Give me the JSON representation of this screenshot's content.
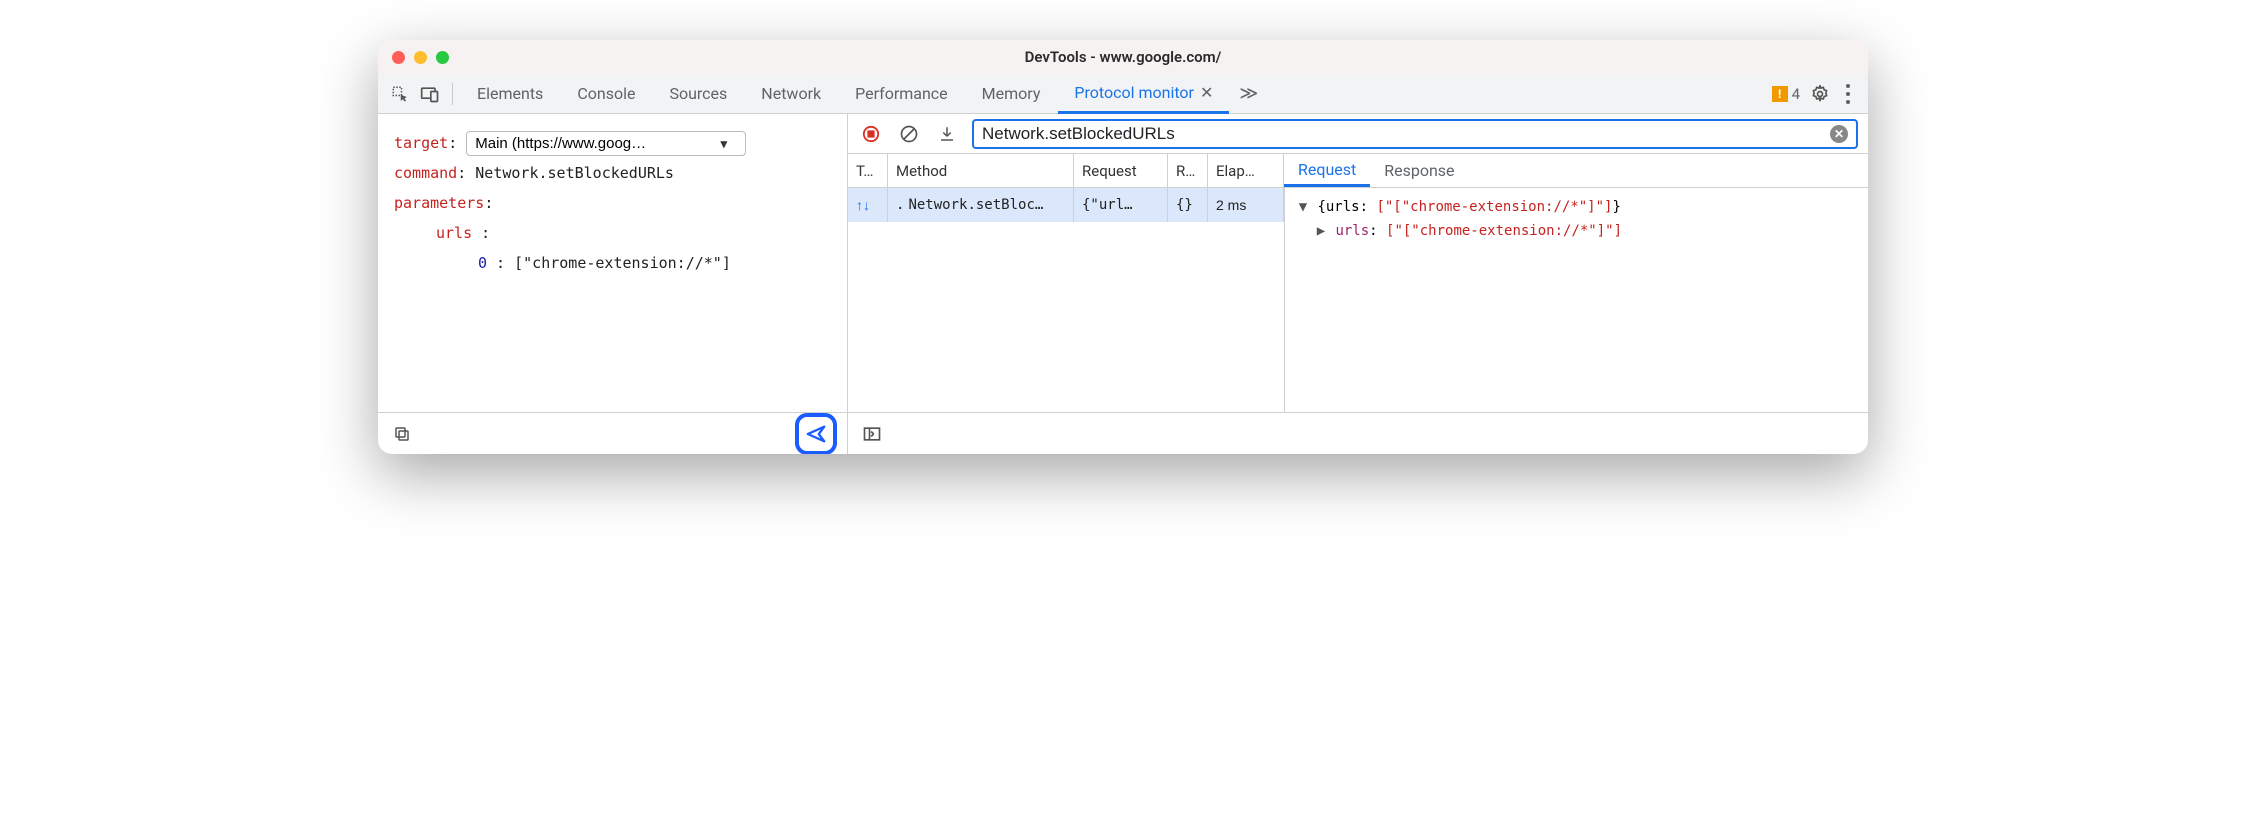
{
  "window": {
    "title": "DevTools - www.google.com/"
  },
  "tabs": {
    "items": [
      "Elements",
      "Console",
      "Sources",
      "Network",
      "Performance",
      "Memory",
      "Protocol monitor"
    ],
    "active": "Protocol monitor",
    "warn_count": "4"
  },
  "editor": {
    "target_label": "target",
    "target_value": "Main (https://www.goog…",
    "command_label": "command",
    "command_value": "Network.setBlockedURLs",
    "parameters_label": "parameters",
    "urls_label": "urls",
    "url_index": "0",
    "url_value": "[\"chrome-extension://*\"]"
  },
  "protocol": {
    "filter_value": "Network.setBlockedURLs",
    "cols": {
      "type": "T…",
      "method": "Method",
      "request": "Request",
      "r": "R…",
      "elap": "Elap…"
    },
    "detail_tabs": {
      "request": "Request",
      "response": "Response"
    },
    "row": {
      "method": "Network.setBloc…",
      "request": "{\"url…",
      "r": "{}",
      "elapsed": "2 ms"
    },
    "detail": {
      "line1_pre": "{urls:",
      "line1_val": "[\"[\"chrome-extension://*\"]\"]",
      "line1_post": "}",
      "line2_key": "urls",
      "line2_val": "[\"[\"chrome-extension://*\"]\"]"
    }
  }
}
